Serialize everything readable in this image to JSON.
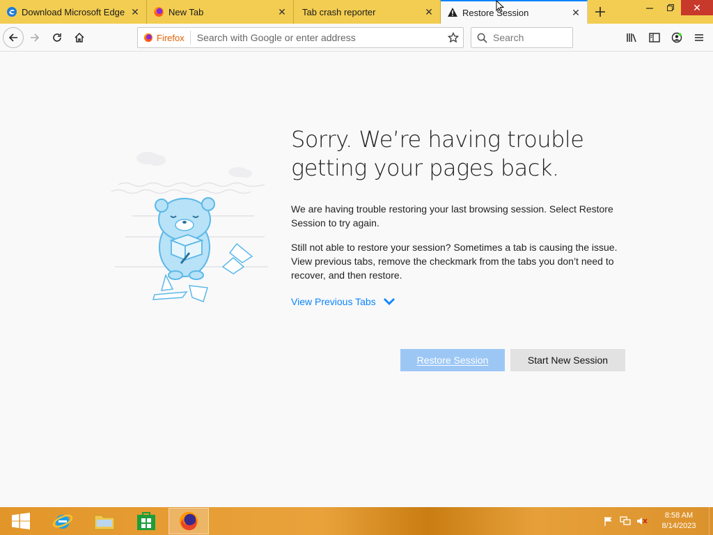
{
  "tabs": [
    {
      "title": "Download Microsoft Edge",
      "icon": "edge-icon"
    },
    {
      "title": "New Tab",
      "icon": "firefox-icon"
    },
    {
      "title": "Tab crash reporter",
      "icon": ""
    },
    {
      "title": "Restore Session",
      "icon": "warning-icon",
      "active": true
    }
  ],
  "navbar": {
    "identity_label": "Firefox",
    "url_placeholder": "Search with Google or enter address",
    "search_placeholder": "Search"
  },
  "page": {
    "title": "Sorry. We’re having trouble getting your pages back.",
    "para1": "We are having trouble restoring your last browsing session. Select Restore Session to try again.",
    "para2": "Still not able to restore your session? Sometimes a tab is causing the issue. View previous tabs, remove the checkmark from the tabs you don’t need to recover, and then restore.",
    "view_previous": "View Previous Tabs",
    "restore_button": "Restore Session",
    "new_session_button": "Start New Session"
  },
  "taskbar": {
    "time": "8:58 AM",
    "date": "8/14/2023"
  },
  "colors": {
    "tabstrip": "#f3cd52",
    "accent": "#0a84ff",
    "restore_button": "#9cc7f5"
  }
}
